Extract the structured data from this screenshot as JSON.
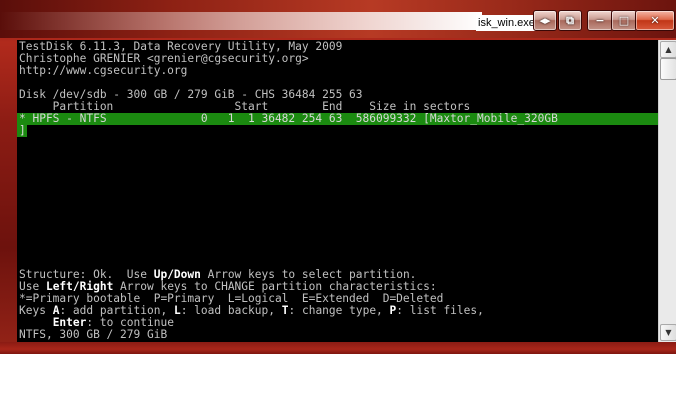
{
  "window": {
    "title": "isk_win.exe",
    "buttons": {
      "restore_icon": "◂▸",
      "popout_icon": "⧉",
      "minimize": "−",
      "maximize": "□",
      "close": "✕"
    }
  },
  "console": {
    "lines": [
      "TestDisk 6.11.3, Data Recovery Utility, May 2009",
      "Christophe GRENIER <grenier@cgsecurity.org>",
      "http://www.cgsecurity.org",
      "",
      "Disk /dev/sdb - 300 GB / 279 GiB - CHS 36484 255 63",
      "     Partition                  Start        End    Size in sectors",
      "* HPFS - NTFS              0   1  1 36482 254 63  586099332 [Maxtor_Mobile_320GB",
      "]"
    ],
    "status": {
      "l1_a": "Structure: Ok.  Use ",
      "l1_b": "Up/Down",
      "l1_c": " Arrow keys to select partition.",
      "l2_a": "Use ",
      "l2_b": "Left/Right",
      "l2_c": " Arrow keys to CHANGE partition characteristics:",
      "l3": "*=Primary bootable  P=Primary  L=Logical  E=Extended  D=Deleted",
      "l4_a": "Keys ",
      "l4_b": "A",
      "l4_c": ": add partition, ",
      "l4_d": "L",
      "l4_e": ": load backup, ",
      "l4_f": "T",
      "l4_g": ": change type, ",
      "l4_h": "P",
      "l4_i": ": list files,",
      "l5_a": "     ",
      "l5_b": "Enter",
      "l5_c": ": to continue",
      "l6": "NTFS, 300 GB / 279 GiB"
    }
  },
  "scrollbar": {
    "up_icon": "▲",
    "down_icon": "▼"
  }
}
